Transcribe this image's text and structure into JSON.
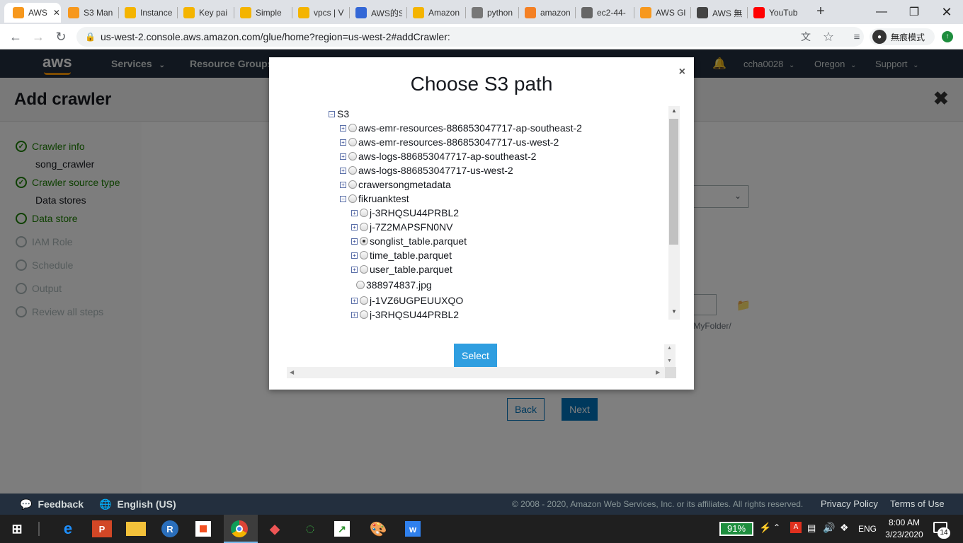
{
  "browser": {
    "tabs": [
      {
        "title": "AWS",
        "favicon": "aws-icon",
        "color": "#f7981d",
        "active": true
      },
      {
        "title": "S3 Man",
        "favicon": "aws-icon",
        "color": "#f7981d"
      },
      {
        "title": "Instance",
        "favicon": "aws-box-icon",
        "color": "#f4b400"
      },
      {
        "title": "Key pai",
        "favicon": "aws-box-icon",
        "color": "#f4b400"
      },
      {
        "title": "Simple",
        "favicon": "aws-box-icon",
        "color": "#f4b400"
      },
      {
        "title": "vpcs | V",
        "favicon": "aws-box-icon",
        "color": "#f4b400"
      },
      {
        "title": "AWS的S",
        "favicon": "doc-icon",
        "color": "#3367d6"
      },
      {
        "title": "Amazon",
        "favicon": "aws-box-icon",
        "color": "#f4b400"
      },
      {
        "title": "python",
        "favicon": "tools-icon",
        "color": "#777777"
      },
      {
        "title": "amazon",
        "favicon": "stackoverflow-icon",
        "color": "#f48024"
      },
      {
        "title": "ec2-44-",
        "favicon": "globe-icon",
        "color": "#666666"
      },
      {
        "title": "AWS Gl",
        "favicon": "aws-icon",
        "color": "#f7981d"
      },
      {
        "title": "AWS 無",
        "favicon": "rocket-icon",
        "color": "#444444"
      },
      {
        "title": "YouTub",
        "favicon": "youtube-icon",
        "color": "#ff0000"
      }
    ],
    "url": "us-west-2.console.aws.amazon.com/glue/home?region=us-west-2#addCrawler:",
    "incognito_label": "無痕模式"
  },
  "aws_header": {
    "logo": "aws",
    "services": "Services",
    "resource_groups": "Resource Groups",
    "user": "ccha0028",
    "region": "Oregon",
    "support": "Support"
  },
  "page": {
    "title": "Add crawler",
    "steps": [
      {
        "label": "Crawler info",
        "state": "done",
        "sub": "song_crawler"
      },
      {
        "label": "Crawler source type",
        "state": "done",
        "sub": "Data stores"
      },
      {
        "label": "Data store",
        "state": "current"
      },
      {
        "label": "IAM Role",
        "state": "pending"
      },
      {
        "label": "Schedule",
        "state": "pending"
      },
      {
        "label": "Output",
        "state": "pending"
      },
      {
        "label": "Review all steps",
        "state": "pending"
      }
    ],
    "path_hint": "et/MyFolder/",
    "back_label": "Back",
    "next_label": "Next"
  },
  "modal": {
    "title": "Choose S3 path",
    "close": "×",
    "select_label": "Select",
    "tree": [
      {
        "label": "S3",
        "level": 0,
        "expander": "minus",
        "radio": false
      },
      {
        "label": "aws-emr-resources-886853047717-ap-southeast-2",
        "level": 1,
        "expander": "plus",
        "radio": true
      },
      {
        "label": "aws-emr-resources-886853047717-us-west-2",
        "level": 1,
        "expander": "plus",
        "radio": true
      },
      {
        "label": "aws-logs-886853047717-ap-southeast-2",
        "level": 1,
        "expander": "plus",
        "radio": true
      },
      {
        "label": "aws-logs-886853047717-us-west-2",
        "level": 1,
        "expander": "plus",
        "radio": true
      },
      {
        "label": "crawersongmetadata",
        "level": 1,
        "expander": "plus",
        "radio": true
      },
      {
        "label": "fikruanktest",
        "level": 1,
        "expander": "minus",
        "radio": true
      },
      {
        "label": "j-3RHQSU44PRBL2",
        "level": 2,
        "expander": "plus",
        "radio": true
      },
      {
        "label": "j-7Z2MAPSFN0NV",
        "level": 2,
        "expander": "plus",
        "radio": true
      },
      {
        "label": "songlist_table.parquet",
        "level": 2,
        "expander": "plus",
        "radio": true,
        "checked": true
      },
      {
        "label": "time_table.parquet",
        "level": 2,
        "expander": "plus",
        "radio": true
      },
      {
        "label": "user_table.parquet",
        "level": 2,
        "expander": "plus",
        "radio": true
      },
      {
        "label": "388974837.jpg",
        "level": 2,
        "expander": "none",
        "radio": true
      },
      {
        "label": "j-1VZ6UGPEUUXQO",
        "level": 2,
        "expander": "plus",
        "radio": true
      },
      {
        "label": "j-3RHQSU44PRBL2",
        "level": 2,
        "expander": "plus",
        "radio": true
      }
    ]
  },
  "footer": {
    "feedback": "Feedback",
    "language": "English (US)",
    "copyright": "© 2008 - 2020, Amazon Web Services, Inc. or its affiliates. All rights reserved.",
    "privacy": "Privacy Policy",
    "terms": "Terms of Use"
  },
  "taskbar": {
    "battery": "91%",
    "lang": "ENG",
    "time": "8:00 AM",
    "date": "3/23/2020",
    "notifications": "14"
  }
}
